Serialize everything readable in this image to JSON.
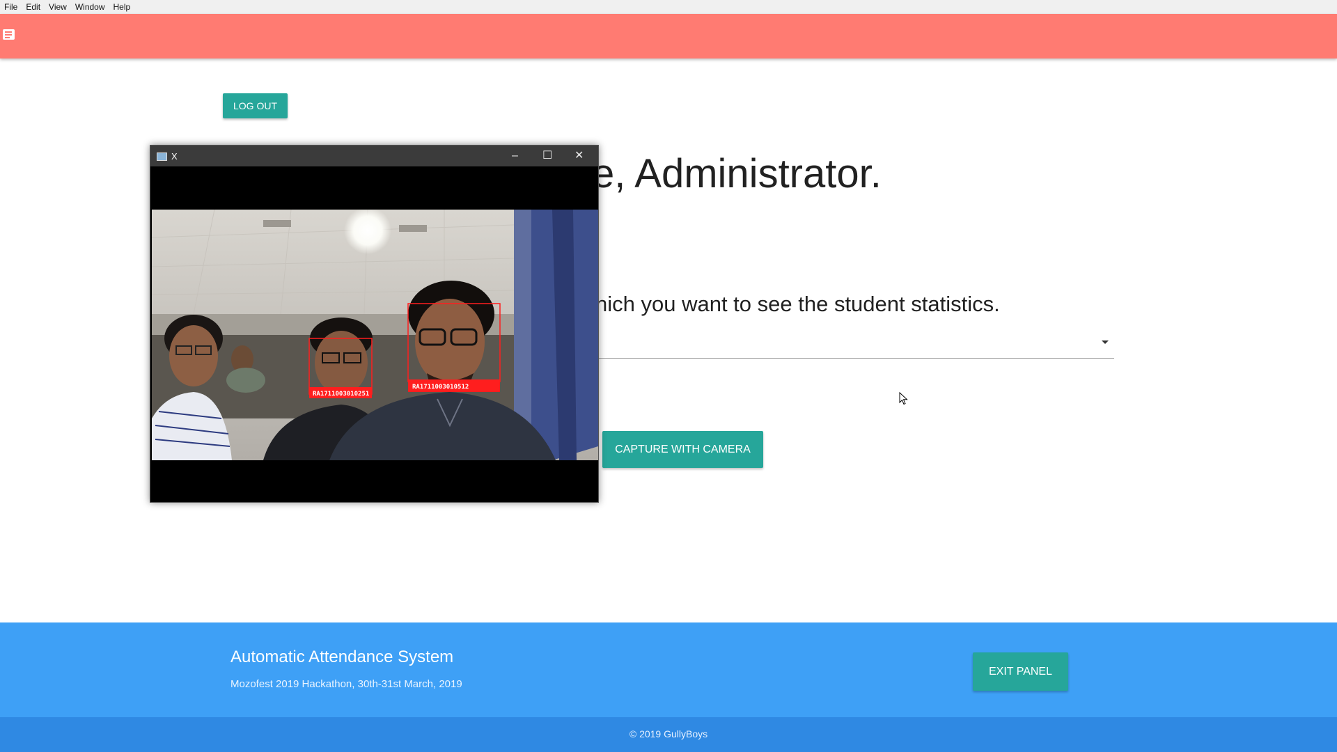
{
  "menubar": {
    "items": [
      "File",
      "Edit",
      "View",
      "Window",
      "Help"
    ]
  },
  "navbar": {
    "icon": "menu-icon",
    "color": "#ff7b72"
  },
  "buttons": {
    "logout": "LOG OUT",
    "capture": "CAPTURE WITH CAMERA",
    "exit": "EXIT PANEL"
  },
  "main": {
    "welcome": "e, Administrator.",
    "instruction": "hich you want to see the student statistics."
  },
  "camera_window": {
    "title": "X",
    "controls": {
      "minimize": "–",
      "maximize": "☐",
      "close": "✕"
    },
    "detections": [
      {
        "label": "RA1711003010251"
      },
      {
        "label": "RA1711003010512"
      }
    ]
  },
  "footer": {
    "title": "Automatic Attendance System",
    "subtitle": "Mozofest 2019 Hackathon, 30th-31st March, 2019",
    "copyright": "© 2019 GullyBoys"
  },
  "colors": {
    "accent": "#26a69a",
    "footer": "#3ea0f6",
    "footer_dark": "#2f89e3"
  }
}
